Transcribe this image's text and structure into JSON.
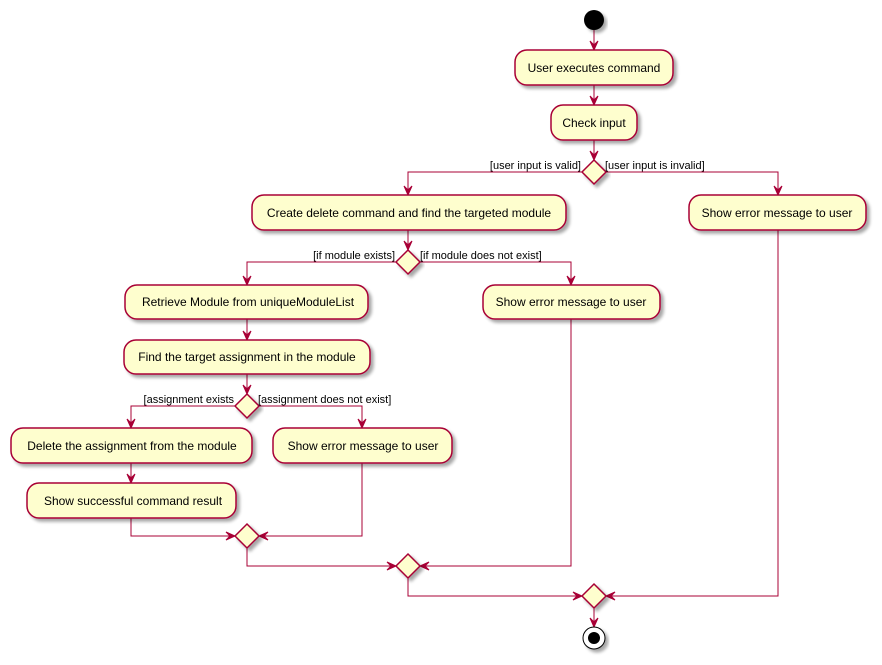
{
  "diagram": {
    "type": "activity",
    "colors": {
      "line": "#A80036",
      "fill": "#FEFECE",
      "shadow": "#C8C8C8",
      "node": "#000000"
    },
    "nodes": {
      "start": {
        "kind": "start"
      },
      "user_executes": {
        "kind": "action",
        "label": "User executes command"
      },
      "check_input": {
        "kind": "action",
        "label": "Check input"
      },
      "d_input": {
        "kind": "decision"
      },
      "create_delete": {
        "kind": "action",
        "label": "Create delete command and find the targeted module"
      },
      "error_invalid": {
        "kind": "action",
        "label": "Show error message to user"
      },
      "d_module": {
        "kind": "decision"
      },
      "retrieve_module": {
        "kind": "action",
        "label": "Retrieve Module from uniqueModuleList"
      },
      "error_no_module": {
        "kind": "action",
        "label": "Show error message to user"
      },
      "find_assignment": {
        "kind": "action",
        "label": "Find the target assignment in the module"
      },
      "d_assignment": {
        "kind": "decision"
      },
      "delete_assignment": {
        "kind": "action",
        "label": "Delete the assignment from the module"
      },
      "error_no_assignment": {
        "kind": "action",
        "label": "Show error message to user"
      },
      "show_success": {
        "kind": "action",
        "label": "Show successful command result"
      },
      "m_assignment": {
        "kind": "merge"
      },
      "m_module": {
        "kind": "merge"
      },
      "m_input": {
        "kind": "merge"
      },
      "end": {
        "kind": "end"
      }
    },
    "guards": {
      "input_valid": "[user input is valid]",
      "input_invalid": "[user input is invalid]",
      "module_exists": "[if module exists]",
      "module_missing": "[if module does not exist]",
      "assignment_exists": "[assignment exists",
      "assignment_missing": "[assignment does not exist]"
    },
    "edges": [
      {
        "from": "start",
        "to": "user_executes"
      },
      {
        "from": "user_executes",
        "to": "check_input"
      },
      {
        "from": "check_input",
        "to": "d_input"
      },
      {
        "from": "d_input",
        "to": "create_delete",
        "guard": "[user input is valid]"
      },
      {
        "from": "d_input",
        "to": "error_invalid",
        "guard": "[user input is invalid]"
      },
      {
        "from": "create_delete",
        "to": "d_module"
      },
      {
        "from": "d_module",
        "to": "retrieve_module",
        "guard": "[if module exists]"
      },
      {
        "from": "d_module",
        "to": "error_no_module",
        "guard": "[if module does not exist]"
      },
      {
        "from": "retrieve_module",
        "to": "find_assignment"
      },
      {
        "from": "find_assignment",
        "to": "d_assignment"
      },
      {
        "from": "d_assignment",
        "to": "delete_assignment",
        "guard": "[assignment exists"
      },
      {
        "from": "d_assignment",
        "to": "error_no_assignment",
        "guard": "[assignment does not exist]"
      },
      {
        "from": "delete_assignment",
        "to": "show_success"
      },
      {
        "from": "show_success",
        "to": "m_assignment"
      },
      {
        "from": "error_no_assignment",
        "to": "m_assignment"
      },
      {
        "from": "m_assignment",
        "to": "m_module"
      },
      {
        "from": "error_no_module",
        "to": "m_module"
      },
      {
        "from": "m_module",
        "to": "m_input"
      },
      {
        "from": "error_invalid",
        "to": "m_input"
      },
      {
        "from": "m_input",
        "to": "end"
      }
    ]
  }
}
